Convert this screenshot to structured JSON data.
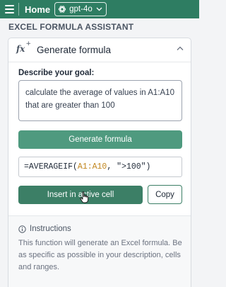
{
  "topbar": {
    "title": "Home",
    "model": "gpt-4o"
  },
  "assistant": {
    "title": "EXCEL FORMULA ASSISTANT"
  },
  "card": {
    "title": "Generate formula",
    "goal_label": "Describe your goal:",
    "goal_text": "calculate the average of values in A1:A10 that are greater than 100",
    "generate_label": "Generate formula",
    "formula": {
      "prefix": "=AVERAGEIF(",
      "range": "A1:A10",
      "suffix": ", \">100\")"
    },
    "insert_label": "Insert in active cell",
    "copy_label": "Copy"
  },
  "instructions": {
    "title": "Instructions",
    "text": "This function will generate an Excel formula. Be as specific as possible in your description, cells and ranges."
  },
  "colors": {
    "brand": "#2e7d62",
    "primary_button": "#4f9a7f",
    "insert_button": "#3c7f66",
    "range_highlight": "#c2871f"
  },
  "icons": [
    "menu-icon",
    "openai-logo-icon",
    "chevron-down-icon",
    "function-icon",
    "chevron-up-icon",
    "info-icon",
    "hand-pointer-icon"
  ]
}
